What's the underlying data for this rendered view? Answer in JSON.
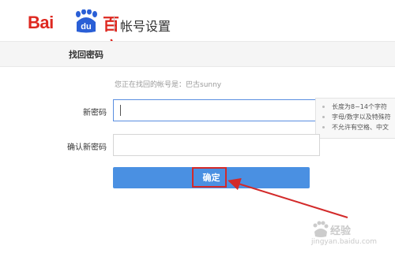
{
  "header": {
    "logo_letters": "Bai",
    "logo_du": "du",
    "logo_cn": "百度",
    "title": "帐号设置"
  },
  "subnav": {
    "title": "找回密码"
  },
  "form": {
    "info_text": "您正在找回的帐号是：巴古sunny",
    "new_password_label": "新密码",
    "new_password_value": "",
    "confirm_password_label": "确认新密码",
    "confirm_password_value": "",
    "submit_label": "确定"
  },
  "tip": {
    "items": [
      "长度为8~14个字符",
      "字母/数字以及特殊符",
      "不允许有空格、中文"
    ]
  },
  "watermark": {
    "text": "经验",
    "url": "jingyan.baidu.com"
  },
  "colors": {
    "brand_red": "#de2820",
    "button_blue": "#4a90e2",
    "annotation_red": "#d32a2a"
  }
}
